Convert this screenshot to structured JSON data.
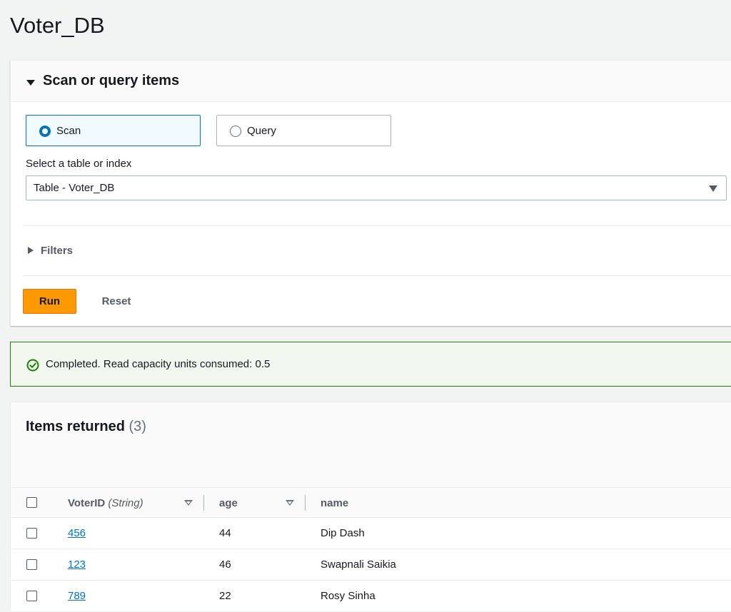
{
  "page": {
    "title": "Voter_DB"
  },
  "scan_panel": {
    "title": "Scan or query items",
    "modes": [
      {
        "label": "Scan",
        "selected": true
      },
      {
        "label": "Query",
        "selected": false
      }
    ],
    "select_label": "Select a table or index",
    "select_value": "Table - Voter_DB",
    "filters_label": "Filters",
    "run_label": "Run",
    "reset_label": "Reset"
  },
  "status": {
    "text": "Completed. Read capacity units consumed: 0.5",
    "color": "#1d8102"
  },
  "items": {
    "title": "Items returned",
    "count": "(3)",
    "columns": [
      {
        "name": "VoterID",
        "type": "(String)"
      },
      {
        "name": "age"
      },
      {
        "name": "name"
      }
    ],
    "rows": [
      {
        "voterid": "456",
        "age": "44",
        "name": "Dip Dash"
      },
      {
        "voterid": "123",
        "age": "46",
        "name": "Swapnali Saikia"
      },
      {
        "voterid": "789",
        "age": "22",
        "name": "Rosy Sinha"
      }
    ]
  },
  "colors": {
    "accent": "#0073bb",
    "primary_button": "#ff9900",
    "success": "#1d8102"
  }
}
